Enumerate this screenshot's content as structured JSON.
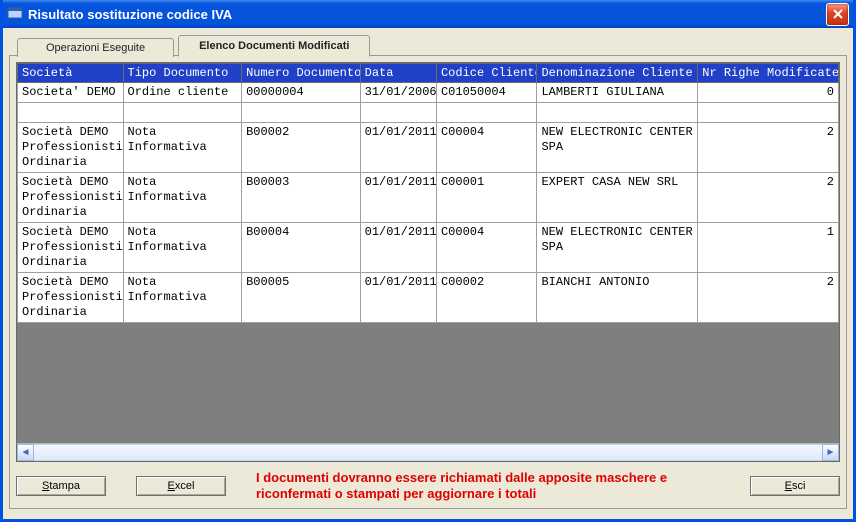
{
  "window": {
    "title": "Risultato sostituzione codice IVA"
  },
  "tabs": {
    "inactive": "Operazioni Eseguite",
    "active": "Elenco Documenti Modificati"
  },
  "columns": {
    "c0": "Società",
    "c1": "Tipo Documento",
    "c2": "Numero Documento",
    "c3": "Data",
    "c4": "Codice Cliente",
    "c5": "Denominazione Cliente",
    "c6": "Nr Righe Modificate"
  },
  "rows": [
    {
      "soc": "Societa' DEMO",
      "tipo": "Ordine cliente",
      "num": "00000004",
      "data": "31/01/2006",
      "cod": "C01050004",
      "den": "LAMBERTI GIULIANA",
      "nr": "0"
    },
    {
      "soc": "Società DEMO Professionisti Ordinaria",
      "tipo": "Nota Informativa",
      "num": "B00002",
      "data": "01/01/2011",
      "cod": "C00004",
      "den": "NEW ELECTRONIC CENTER SPA",
      "nr": "2"
    },
    {
      "soc": "Società DEMO Professionisti Ordinaria",
      "tipo": "Nota Informativa",
      "num": "B00003",
      "data": "01/01/2011",
      "cod": "C00001",
      "den": "EXPERT CASA NEW SRL",
      "nr": "2"
    },
    {
      "soc": "Società DEMO Professionisti Ordinaria",
      "tipo": "Nota Informativa",
      "num": "B00004",
      "data": "01/01/2011",
      "cod": "C00004",
      "den": "NEW ELECTRONIC CENTER SPA",
      "nr": "1"
    },
    {
      "soc": "Società DEMO Professionisti Ordinaria",
      "tipo": "Nota Informativa",
      "num": "B00005",
      "data": "01/01/2011",
      "cod": "C00002",
      "den": "BIANCHI ANTONIO",
      "nr": "2"
    }
  ],
  "warning": "I documenti dovranno essere richiamati dalle apposite maschere e riconfermati o stampati per aggiornare i totali",
  "buttons": {
    "stampa_u": "S",
    "stampa_r": "tampa",
    "excel_u": "E",
    "excel_r": "xcel",
    "esci_u": "E",
    "esci_r": "sci"
  }
}
